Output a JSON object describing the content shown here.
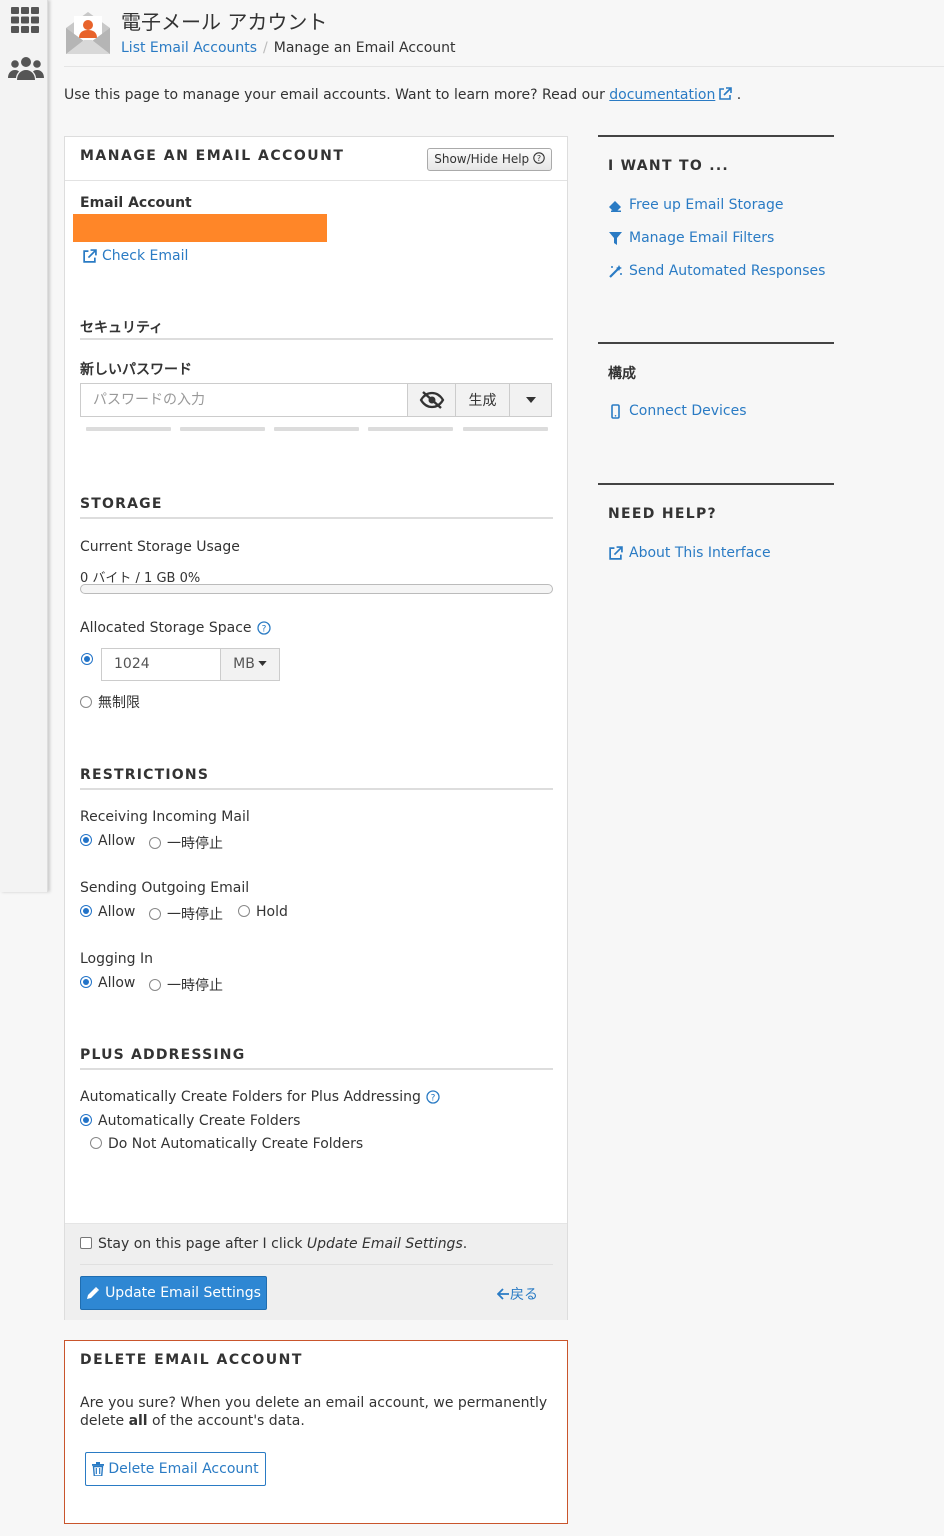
{
  "header": {
    "title": "電子メール アカウント",
    "breadcrumb_link": "List Email Accounts",
    "breadcrumb_sep": "/",
    "breadcrumb_current": "Manage an Email Account"
  },
  "intro": {
    "text": "Use this page to manage your email accounts. Want to learn more? Read our ",
    "link": "documentation",
    "tail": "."
  },
  "panel": {
    "title": "MANAGE AN EMAIL ACCOUNT",
    "help_button": "Show/Hide Help",
    "email_label": "Email Account",
    "check_email": "Check Email",
    "security_title": "セキュリティ",
    "new_password_label": "新しいパスワード",
    "password_placeholder": "パスワードの入力",
    "generate_button": "生成",
    "storage_title": "STORAGE",
    "current_usage_label": "Current Storage Usage",
    "usage_value": "0 バイト / 1 GB 0%",
    "usage_fraction": 0,
    "allocated_label": "Allocated Storage Space",
    "quota_value": "1024",
    "quota_unit": "MB",
    "unlimited_label": "無制限",
    "restrictions_title": "RESTRICTIONS",
    "receiving_label": "Receiving Incoming Mail",
    "sending_label": "Sending Outgoing Email",
    "logging_label": "Logging In",
    "allow": "Allow",
    "suspend": "一時停止",
    "hold": "Hold",
    "plus_title": "PLUS ADDRESSING",
    "plus_label": "Automatically Create Folders for Plus Addressing",
    "plus_auto": "Automatically Create Folders",
    "plus_no_auto": "Do Not Automatically Create Folders",
    "stay_text": "Stay on this page after I click ",
    "stay_em": "Update Email Settings",
    "stay_tail": ".",
    "update_button": "Update Email Settings",
    "back_link": "戻る"
  },
  "delete_panel": {
    "title": "DELETE EMAIL ACCOUNT",
    "text_line1": "Are you sure? When you delete an email account, we permanently",
    "text_line2_pre": "delete ",
    "text_line2_bold": "all",
    "text_line2_post": " of the account's data.",
    "button": "Delete Email Account"
  },
  "sidebar_right": {
    "want_title": "I WANT TO ...",
    "want_links": [
      "Free up Email Storage",
      "Manage Email Filters",
      "Send Automated Responses"
    ],
    "config_title": "構成",
    "config_link": "Connect Devices",
    "help_title": "NEED HELP?",
    "help_link": "About This Interface"
  },
  "colors": {
    "accent": "#2a7bc4",
    "redaction": "#ff8628",
    "danger_border": "#c9552c"
  }
}
